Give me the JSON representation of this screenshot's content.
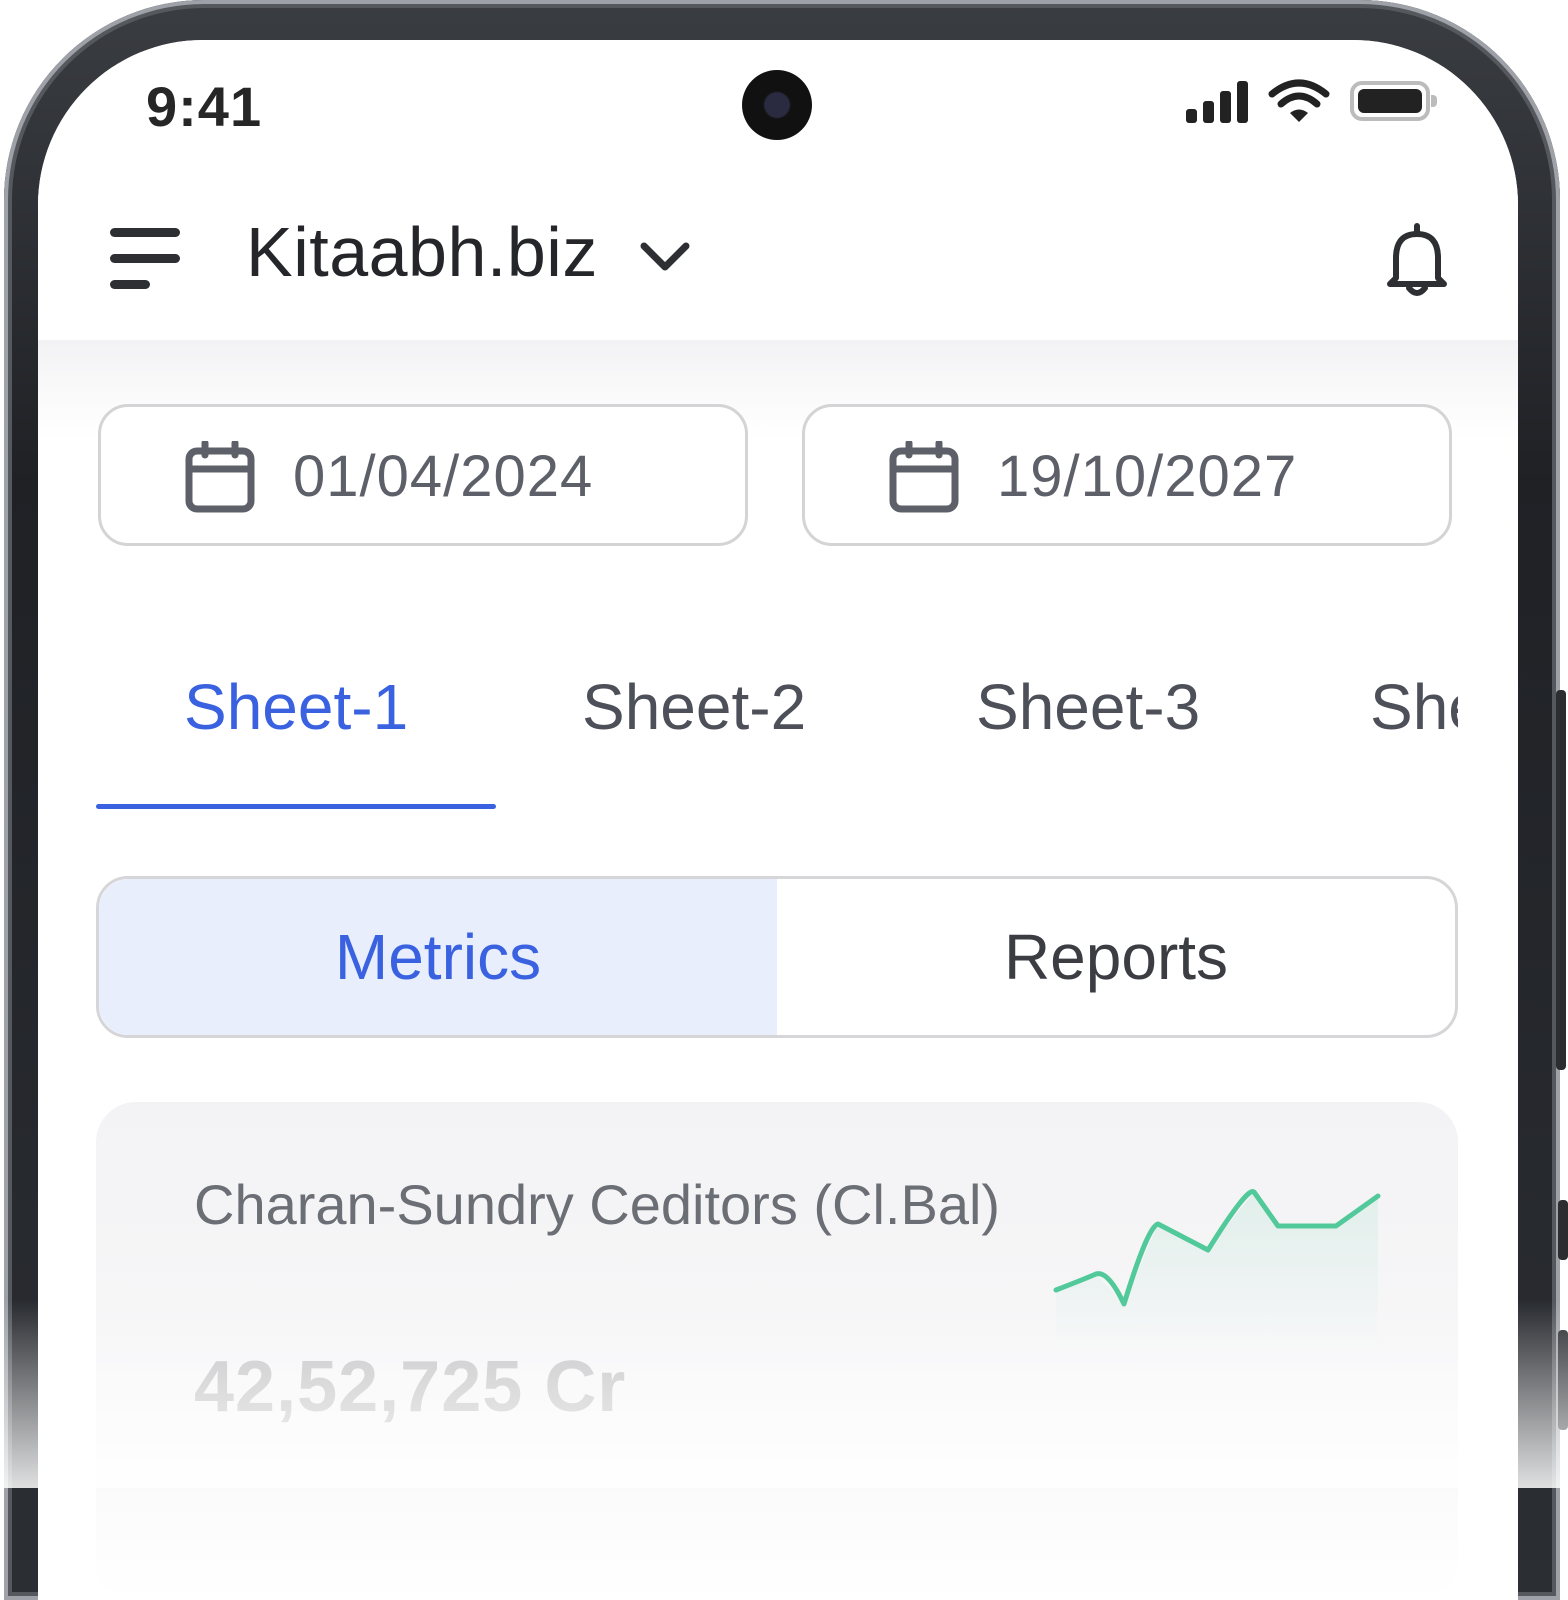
{
  "status_bar": {
    "time": "9:41"
  },
  "header": {
    "title": "Kitaabh.biz"
  },
  "date_range": {
    "from": "01/04/2024",
    "to": "19/10/2027"
  },
  "tabs": [
    {
      "label": "Sheet-1",
      "active": true
    },
    {
      "label": "Sheet-2",
      "active": false
    },
    {
      "label": "Sheet-3",
      "active": false
    },
    {
      "label": "She",
      "active": false
    }
  ],
  "segments": {
    "left": "Metrics",
    "right": "Reports",
    "selected": "Metrics"
  },
  "metric_card": {
    "label": "Charan-Sundry Ceditors (Cl.Bal)",
    "value": "42,52,725 Cr",
    "trend_color": "#52c99a"
  },
  "colors": {
    "accent": "#3a62e0",
    "segment_selected_bg": "#e8eefc"
  },
  "icons": [
    "menu-icon",
    "chevron-down-icon",
    "bell-icon",
    "calendar-icon",
    "signal-icon",
    "wifi-icon",
    "battery-icon",
    "camera-icon"
  ]
}
